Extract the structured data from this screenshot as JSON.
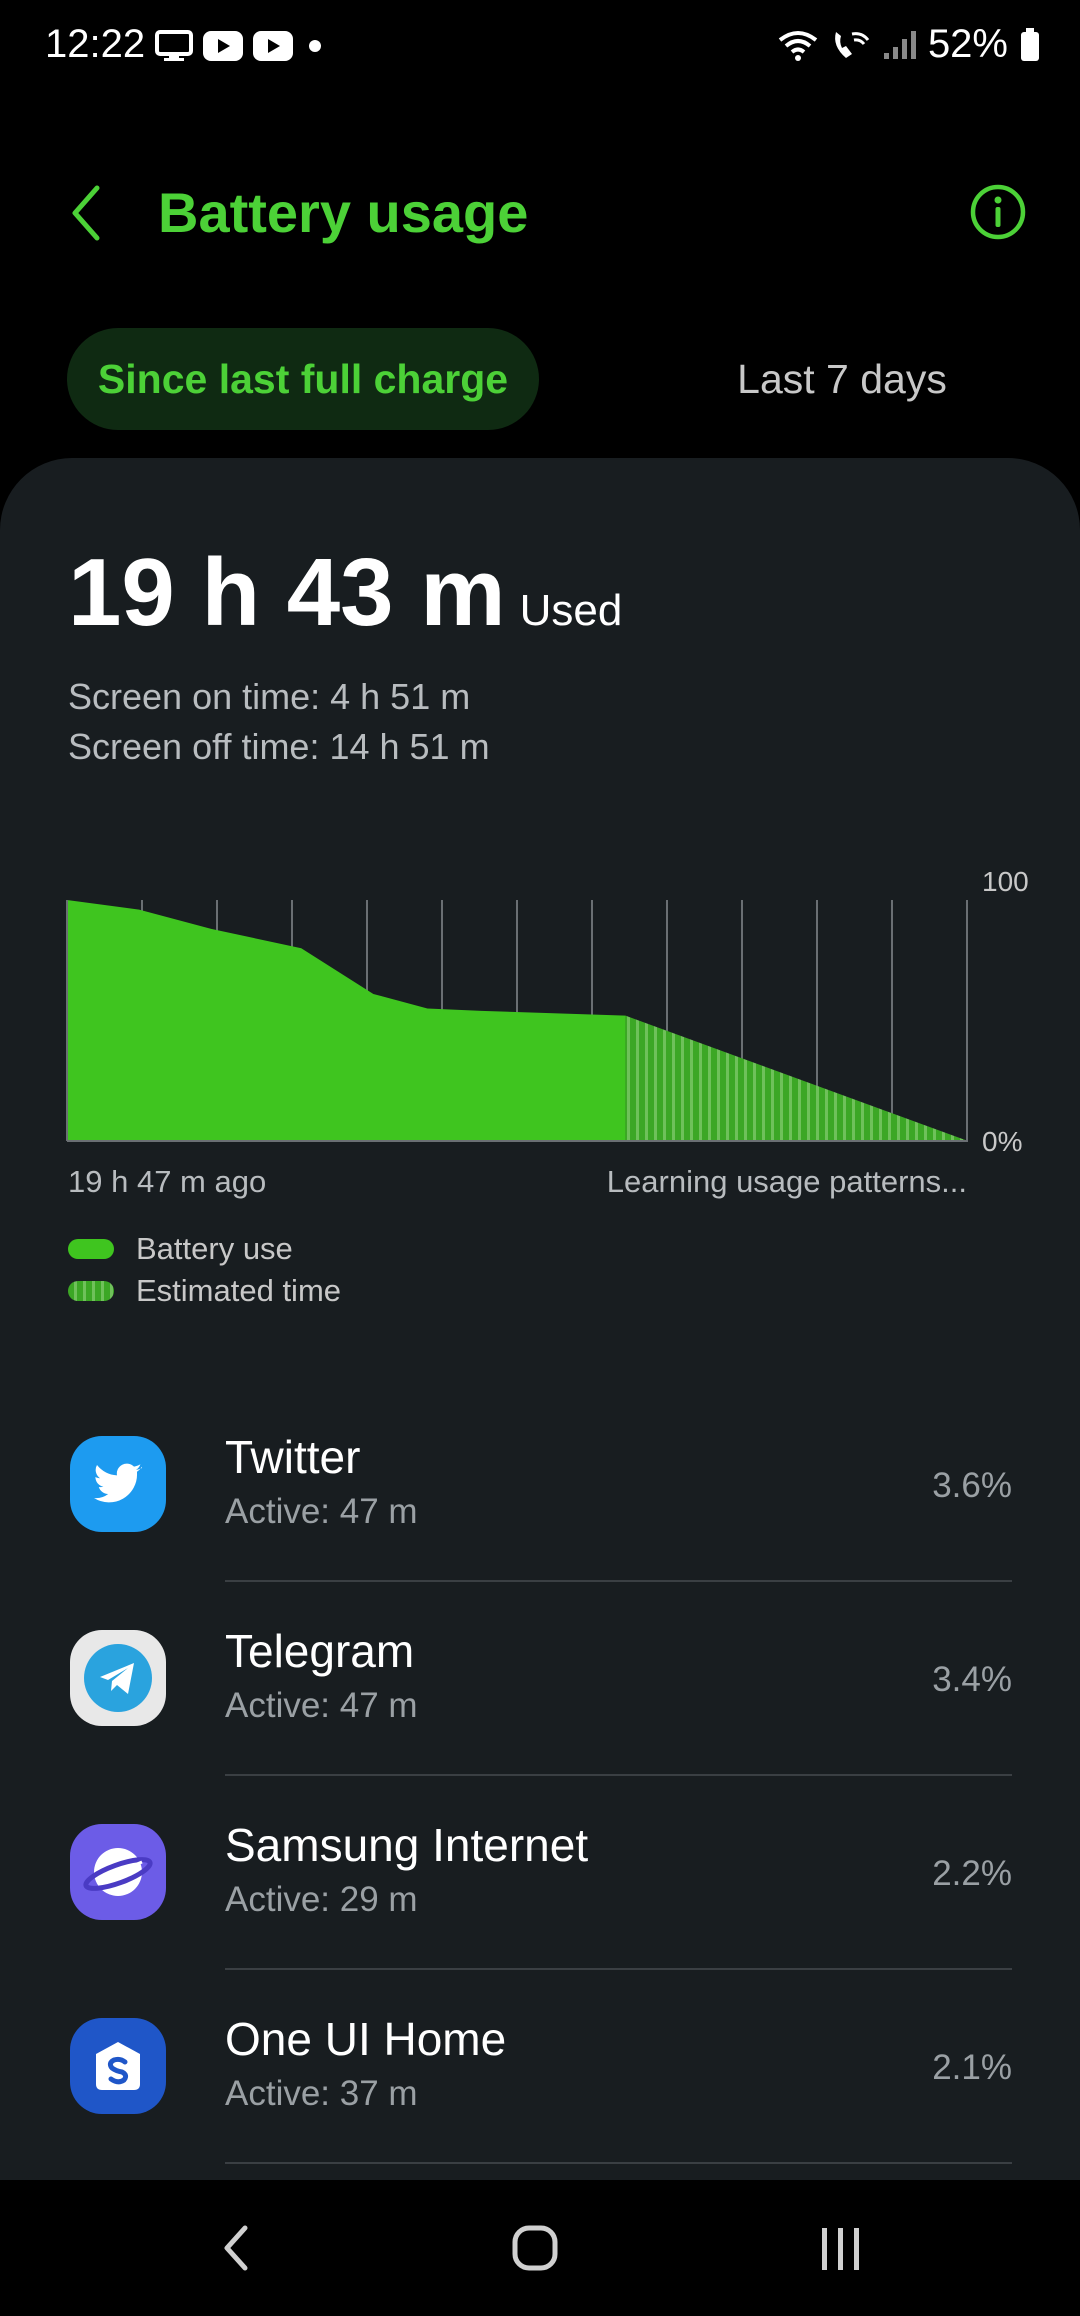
{
  "status_bar": {
    "time": "12:22",
    "left_icons": [
      "monitor-icon",
      "youtube-icon",
      "youtube-icon",
      "dot-icon"
    ],
    "right_icons": [
      "wifi-icon",
      "wifi-call-icon",
      "signal-icon",
      "battery-icon"
    ],
    "battery_percent": "52%"
  },
  "header": {
    "title": "Battery usage",
    "accent_color": "#4cd137"
  },
  "tabs": [
    {
      "label": "Since last full charge",
      "active": true
    },
    {
      "label": "Last 7 days",
      "active": false
    }
  ],
  "summary": {
    "used_time": "19 h 43 m",
    "used_label": "Used",
    "screen_on": "Screen on time: 4 h 51 m",
    "screen_off": "Screen off time: 14 h 51 m"
  },
  "chart_data": {
    "type": "area",
    "y_top_label": "100",
    "y_bottom_label": "0%",
    "x_start_label": "19 h 47 m ago",
    "x_end_label": "Learning usage patterns...",
    "ylim": [
      0,
      100
    ],
    "grid": true,
    "series": [
      {
        "name": "Battery use",
        "x": [
          0,
          0.08,
          0.16,
          0.26,
          0.34,
          0.4,
          0.46,
          0.62
        ],
        "values": [
          100,
          96,
          88,
          80,
          61,
          55,
          54,
          52
        ]
      },
      {
        "name": "Estimated time",
        "x": [
          0.62,
          1.0
        ],
        "values": [
          52,
          0
        ]
      }
    ]
  },
  "legend": [
    {
      "label": "Battery use",
      "style": "solid"
    },
    {
      "label": "Estimated time",
      "style": "striped"
    }
  ],
  "apps": [
    {
      "name": "Twitter",
      "active": "Active: 47 m",
      "percent": "3.6%",
      "icon": "twitter-icon",
      "color": "#1d9bf0"
    },
    {
      "name": "Telegram",
      "active": "Active: 47 m",
      "percent": "3.4%",
      "icon": "telegram-icon",
      "color": "#2aa3de"
    },
    {
      "name": "Samsung Internet",
      "active": "Active: 29 m",
      "percent": "2.2%",
      "icon": "samsung-internet-icon",
      "color": "#6c5ce7"
    },
    {
      "name": "One UI Home",
      "active": "Active: 37 m",
      "percent": "2.1%",
      "icon": "one-ui-home-icon",
      "color": "#1f56c8"
    }
  ],
  "nav_bar": {
    "buttons": [
      "back-icon",
      "home-icon",
      "recents-icon"
    ]
  }
}
